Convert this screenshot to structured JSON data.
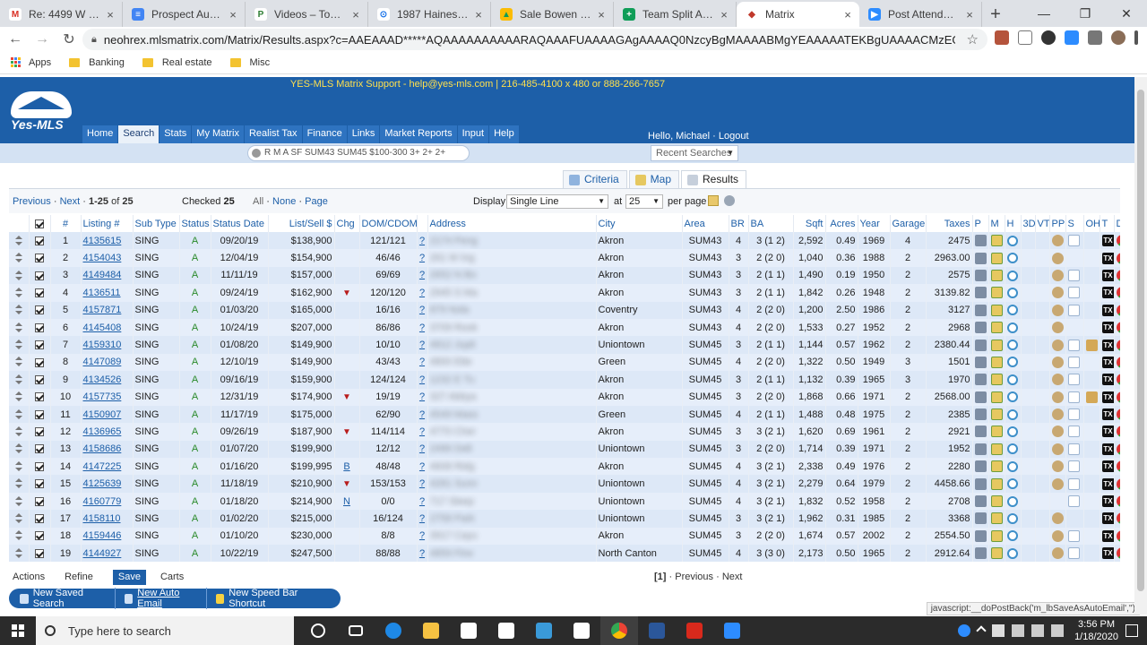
{
  "browser": {
    "tabs": [
      {
        "title": "Re: 4499 W 139th",
        "icon": "gmail-icon",
        "color": "#ffffff",
        "glyph": "M",
        "glyph_color": "#d93025"
      },
      {
        "title": "Prospect Auto Foll",
        "icon": "docs-icon",
        "color": "#4285f4",
        "glyph": "≡",
        "glyph_color": "#ffffff"
      },
      {
        "title": "Videos – Top Prod",
        "icon": "video-icon",
        "color": "#ffffff",
        "glyph": "P",
        "glyph_color": "#2d7d32"
      },
      {
        "title": "1987 Haines Rd, M",
        "icon": "map-pin-icon",
        "color": "#ffffff",
        "glyph": "⊙",
        "glyph_color": "#1a73e8"
      },
      {
        "title": "Sale Bowen - Goo",
        "icon": "drive-icon",
        "color": "#fbbc04",
        "glyph": "▲",
        "glyph_color": "#0f9d58"
      },
      {
        "title": "Team Split Agreem",
        "icon": "sheets-icon",
        "color": "#0f9d58",
        "glyph": "+",
        "glyph_color": "#ffffff"
      },
      {
        "title": "Matrix",
        "icon": "matrix-icon",
        "color": "#ffffff",
        "glyph": "◆",
        "glyph_color": "#c0392b",
        "active": true
      },
      {
        "title": "Post Attendee - Zo",
        "icon": "zoom-icon",
        "color": "#2d8cff",
        "glyph": "▶",
        "glyph_color": "#ffffff"
      }
    ],
    "url": "neohrex.mlsmatrix.com/Matrix/Results.aspx?c=AAEAAAD*****AQAAAAAAAAAARAQAAAFUAAAAGAgAAAAQ0NzcyBgMAAAABMgYEAAAAATEKBgUAAAACMzEGBgAAAAIzMQ0CBgcAA...",
    "bookmarks": [
      "Apps",
      "Banking",
      "Real estate",
      "Misc"
    ],
    "status_url": "javascript:__doPostBack('m_lbSaveAsAutoEmail','')"
  },
  "mls": {
    "support": "YES-MLS Matrix Support - help@yes-mls.com | 216-485-4100 x 480 or 888-266-7657",
    "logo": "Yes-MLS",
    "nav": [
      "Home",
      "Search",
      "Stats",
      "My Matrix",
      "Realist Tax",
      "Finance",
      "Links",
      "Market Reports",
      "Input",
      "Help"
    ],
    "active_nav": "Search",
    "hello": "Hello, Michael · Logout",
    "speedbar": "R M A SF SUM43 SUM45 $100-300 3+ 2+ 2+",
    "recent_searches": "Recent Searches",
    "view_tabs": [
      {
        "label": "Criteria",
        "icon": "criteria-icon"
      },
      {
        "label": "Map",
        "icon": "map-icon"
      },
      {
        "label": "Results",
        "icon": "results-icon",
        "active": true
      }
    ],
    "pager": {
      "previous": "Previous",
      "next": "Next",
      "sep": "·",
      "range": "1-25",
      "of_label": "of",
      "total": "25",
      "checked_label": "Checked",
      "checked_count": "25",
      "all": "All",
      "none": "None",
      "page": "Page",
      "display_label": "Display",
      "display_value": "Single Line",
      "at_label": "at",
      "per_page_value": "25",
      "per_page_label": "per page"
    },
    "columns": [
      "",
      "#",
      "Listing #",
      "Sub Type",
      "Status",
      "Status Date",
      "List/Sell $",
      "Chg",
      "DOM/CDOM",
      "",
      "Address",
      "City",
      "Area",
      "BR",
      "BA",
      "Sqft",
      "Acres",
      "Year",
      "Garage",
      "Taxes",
      "P",
      "M",
      "H",
      "3D",
      "VT",
      "PP",
      "S",
      "OH",
      "T",
      "DC",
      "F"
    ],
    "rows": [
      {
        "n": "1",
        "listing": "4135615",
        "sub": "SING",
        "status": "A",
        "date": "09/20/19",
        "price": "$138,900",
        "chg": "",
        "dom": "121/121",
        "addr": "2174 Peng",
        "city": "Akron",
        "area": "SUM43",
        "br": "4",
        "ba": "3 (1 2)",
        "sqft": "2,592",
        "acres": "0.49",
        "year": "1969",
        "garage": "4",
        "taxes": "2475",
        "pp": 1,
        "s": 1,
        "oh": 0
      },
      {
        "n": "2",
        "listing": "4154043",
        "sub": "SING",
        "status": "A",
        "date": "12/04/19",
        "price": "$154,900",
        "chg": "",
        "dom": "46/46",
        "addr": "261 W Ing",
        "city": "Akron",
        "area": "SUM43",
        "br": "3",
        "ba": "2 (2 0)",
        "sqft": "1,040",
        "acres": "0.36",
        "year": "1988",
        "garage": "2",
        "taxes": "2963.00",
        "pp": 1,
        "s": 0,
        "oh": 0
      },
      {
        "n": "3",
        "listing": "4149484",
        "sub": "SING",
        "status": "A",
        "date": "11/11/19",
        "price": "$157,000",
        "chg": "",
        "dom": "69/69",
        "addr": "2652 N Bo",
        "city": "Akron",
        "area": "SUM43",
        "br": "3",
        "ba": "2 (1 1)",
        "sqft": "1,490",
        "acres": "0.19",
        "year": "1950",
        "garage": "2",
        "taxes": "2575",
        "pp": 1,
        "s": 1,
        "oh": 0
      },
      {
        "n": "4",
        "listing": "4136511",
        "sub": "SING",
        "status": "A",
        "date": "09/24/19",
        "price": "$162,900",
        "chg": "down",
        "dom": "120/120",
        "addr": "2945 S Ma",
        "city": "Akron",
        "area": "SUM43",
        "br": "3",
        "ba": "2 (1 1)",
        "sqft": "1,842",
        "acres": "0.26",
        "year": "1948",
        "garage": "2",
        "taxes": "3139.82",
        "pp": 1,
        "s": 1,
        "oh": 0
      },
      {
        "n": "5",
        "listing": "4157871",
        "sub": "SING",
        "status": "A",
        "date": "01/03/20",
        "price": "$165,000",
        "chg": "",
        "dom": "16/16",
        "addr": "879 Nola",
        "city": "Coventry",
        "area": "SUM43",
        "br": "4",
        "ba": "2 (2 0)",
        "sqft": "1,200",
        "acres": "2.50",
        "year": "1986",
        "garage": "2",
        "taxes": "3127",
        "pp": 1,
        "s": 1,
        "oh": 0
      },
      {
        "n": "6",
        "listing": "4145408",
        "sub": "SING",
        "status": "A",
        "date": "10/24/19",
        "price": "$207,000",
        "chg": "",
        "dom": "86/86",
        "addr": "3709 Rook",
        "city": "Akron",
        "area": "SUM43",
        "br": "4",
        "ba": "2 (2 0)",
        "sqft": "1,533",
        "acres": "0.27",
        "year": "1952",
        "garage": "2",
        "taxes": "2968",
        "pp": 1,
        "s": 0,
        "oh": 0
      },
      {
        "n": "7",
        "listing": "4159310",
        "sub": "SING",
        "status": "A",
        "date": "01/08/20",
        "price": "$149,900",
        "chg": "",
        "dom": "10/10",
        "addr": "4812 Jupit",
        "city": "Uniontown",
        "area": "SUM45",
        "br": "3",
        "ba": "2 (1 1)",
        "sqft": "1,144",
        "acres": "0.57",
        "year": "1962",
        "garage": "2",
        "taxes": "2380.44",
        "pp": 1,
        "s": 1,
        "oh": 1
      },
      {
        "n": "8",
        "listing": "4147089",
        "sub": "SING",
        "status": "A",
        "date": "12/10/19",
        "price": "$149,900",
        "chg": "",
        "dom": "43/43",
        "addr": "4800 Ette",
        "city": "Green",
        "area": "SUM45",
        "br": "4",
        "ba": "2 (2 0)",
        "sqft": "1,322",
        "acres": "0.50",
        "year": "1949",
        "garage": "3",
        "taxes": "1501",
        "pp": 1,
        "s": 1,
        "oh": 0
      },
      {
        "n": "9",
        "listing": "4134526",
        "sub": "SING",
        "status": "A",
        "date": "09/16/19",
        "price": "$159,900",
        "chg": "",
        "dom": "124/124",
        "addr": "1232 E Tu",
        "city": "Akron",
        "area": "SUM45",
        "br": "3",
        "ba": "2 (1 1)",
        "sqft": "1,132",
        "acres": "0.39",
        "year": "1965",
        "garage": "3",
        "taxes": "1970",
        "pp": 1,
        "s": 1,
        "oh": 0
      },
      {
        "n": "10",
        "listing": "4157735",
        "sub": "SING",
        "status": "A",
        "date": "12/31/19",
        "price": "$174,900",
        "chg": "down",
        "dom": "19/19",
        "addr": "327 Abbya",
        "city": "Akron",
        "area": "SUM45",
        "br": "3",
        "ba": "2 (2 0)",
        "sqft": "1,868",
        "acres": "0.66",
        "year": "1971",
        "garage": "2",
        "taxes": "2568.00",
        "pp": 1,
        "s": 1,
        "oh": 1
      },
      {
        "n": "11",
        "listing": "4150907",
        "sub": "SING",
        "status": "A",
        "date": "11/17/19",
        "price": "$175,000",
        "chg": "",
        "dom": "62/90",
        "addr": "4549 Mass",
        "city": "Green",
        "area": "SUM45",
        "br": "4",
        "ba": "2 (1 1)",
        "sqft": "1,488",
        "acres": "0.48",
        "year": "1975",
        "garage": "2",
        "taxes": "2385",
        "pp": 1,
        "s": 1,
        "oh": 0
      },
      {
        "n": "12",
        "listing": "4136965",
        "sub": "SING",
        "status": "A",
        "date": "09/26/19",
        "price": "$187,900",
        "chg": "down",
        "dom": "114/114",
        "addr": "4770 Cher",
        "city": "Akron",
        "area": "SUM45",
        "br": "3",
        "ba": "3 (2 1)",
        "sqft": "1,620",
        "acres": "0.69",
        "year": "1961",
        "garage": "2",
        "taxes": "2921",
        "pp": 1,
        "s": 1,
        "oh": 0
      },
      {
        "n": "13",
        "listing": "4158686",
        "sub": "SING",
        "status": "A",
        "date": "01/07/20",
        "price": "$199,900",
        "chg": "",
        "dom": "12/12",
        "addr": "2496 Delt",
        "city": "Uniontown",
        "area": "SUM45",
        "br": "3",
        "ba": "2 (2 0)",
        "sqft": "1,714",
        "acres": "0.39",
        "year": "1971",
        "garage": "2",
        "taxes": "1952",
        "pp": 1,
        "s": 1,
        "oh": 0
      },
      {
        "n": "14",
        "listing": "4147225",
        "sub": "SING",
        "status": "A",
        "date": "01/16/20",
        "price": "$199,995",
        "chg": "B",
        "dom": "48/48",
        "addr": "4608 Ridg",
        "city": "Akron",
        "area": "SUM45",
        "br": "4",
        "ba": "3 (2 1)",
        "sqft": "2,338",
        "acres": "0.49",
        "year": "1976",
        "garage": "2",
        "taxes": "2280",
        "pp": 1,
        "s": 1,
        "oh": 0
      },
      {
        "n": "15",
        "listing": "4125639",
        "sub": "SING",
        "status": "A",
        "date": "11/18/19",
        "price": "$210,900",
        "chg": "down",
        "dom": "153/153",
        "addr": "4281 Sunn",
        "city": "Uniontown",
        "area": "SUM45",
        "br": "4",
        "ba": "3 (2 1)",
        "sqft": "2,279",
        "acres": "0.64",
        "year": "1979",
        "garage": "2",
        "taxes": "4458.66",
        "pp": 1,
        "s": 1,
        "oh": 0
      },
      {
        "n": "16",
        "listing": "4160779",
        "sub": "SING",
        "status": "A",
        "date": "01/18/20",
        "price": "$214,900",
        "chg": "N",
        "dom": "0/0",
        "addr": "717 Sleep",
        "city": "Uniontown",
        "area": "SUM45",
        "br": "4",
        "ba": "3 (2 1)",
        "sqft": "1,832",
        "acres": "0.52",
        "year": "1958",
        "garage": "2",
        "taxes": "2708",
        "pp": 0,
        "s": 1,
        "oh": 0
      },
      {
        "n": "17",
        "listing": "4158110",
        "sub": "SING",
        "status": "A",
        "date": "01/02/20",
        "price": "$215,000",
        "chg": "",
        "dom": "16/124",
        "addr": "2758 Park",
        "city": "Uniontown",
        "area": "SUM45",
        "br": "3",
        "ba": "3 (2 1)",
        "sqft": "1,962",
        "acres": "0.31",
        "year": "1985",
        "garage": "2",
        "taxes": "3368",
        "pp": 1,
        "s": 0,
        "oh": 0
      },
      {
        "n": "18",
        "listing": "4159446",
        "sub": "SING",
        "status": "A",
        "date": "01/10/20",
        "price": "$230,000",
        "chg": "",
        "dom": "8/8",
        "addr": "3917 Cayu",
        "city": "Akron",
        "area": "SUM45",
        "br": "3",
        "ba": "2 (2 0)",
        "sqft": "1,674",
        "acres": "0.57",
        "year": "2002",
        "garage": "2",
        "taxes": "2554.50",
        "pp": 1,
        "s": 1,
        "oh": 0
      },
      {
        "n": "19",
        "listing": "4144927",
        "sub": "SING",
        "status": "A",
        "date": "10/22/19",
        "price": "$247,500",
        "chg": "",
        "dom": "88/88",
        "addr": "4859 Firw",
        "city": "North Canton",
        "area": "SUM45",
        "br": "4",
        "ba": "3 (3 0)",
        "sqft": "2,173",
        "acres": "0.50",
        "year": "1965",
        "garage": "2",
        "taxes": "2912.64",
        "pp": 1,
        "s": 1,
        "oh": 0
      }
    ],
    "footer": {
      "actions": [
        "Actions",
        "Refine",
        "Save",
        "Carts"
      ],
      "pager": "[1]",
      "previous": "Previous",
      "next": "Next",
      "sep": "·",
      "buttons": [
        "New Saved Search",
        "New Auto Email",
        "New Speed Bar Shortcut"
      ]
    }
  },
  "taskbar": {
    "search_placeholder": "Type here to search",
    "time": "3:56 PM",
    "date": "1/18/2020"
  }
}
